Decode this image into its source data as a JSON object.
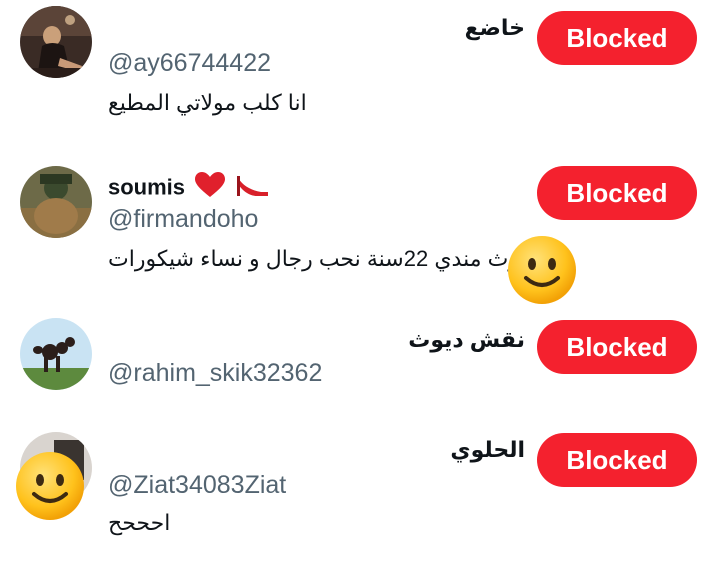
{
  "users": [
    {
      "name": "خاضع",
      "handle": "@ay66744422",
      "bio": "انا كلب مولاتي  المطيع",
      "button_label": "Blocked"
    },
    {
      "name": "soumis",
      "name_icons": [
        "heart-icon",
        "high-heel-icon"
      ],
      "handle": "@firmandoho",
      "bio": "ديوث مندي 22سنة نحب رجال و نساء شيكورات",
      "button_label": "Blocked"
    },
    {
      "name": "نقش ديوث",
      "handle": "@rahim_skik32362",
      "bio": "",
      "button_label": "Blocked"
    },
    {
      "name": "الحلوي",
      "handle": "@Ziat34083Ziat",
      "bio": "احححح",
      "button_label": "Blocked"
    }
  ],
  "colors": {
    "button_bg": "#f4212e",
    "handle_text": "#536471",
    "primary_text": "#0f1419"
  },
  "overlays": [
    "smiley-face-emoji",
    "smiley-face-emoji"
  ]
}
